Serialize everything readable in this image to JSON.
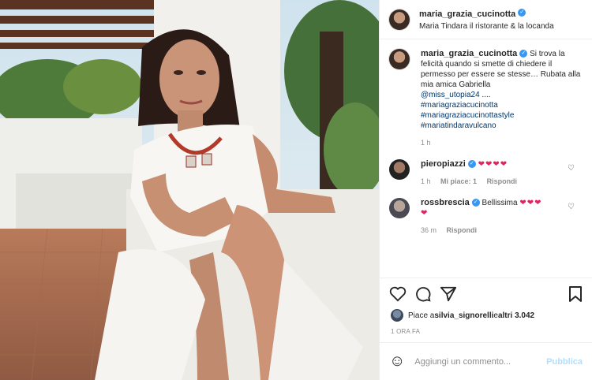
{
  "header": {
    "username": "maria_grazia_cucinotta",
    "location": "Maria Tindara il ristorante & la locanda",
    "verified_icon": "✓"
  },
  "caption": {
    "username": "maria_grazia_cucinotta",
    "text": "Si trova la felicità quando si smette di chiedere il permesso per essere se stesse… Rubata alla mia amica Gabriella",
    "mention": "@miss_utopia24",
    "ellipsis": " ....",
    "hashtags": [
      "#mariagraziacucinotta",
      "#mariagraziacucinottastyle",
      "#mariatindaravulcano"
    ],
    "time": "1 h"
  },
  "comments": [
    {
      "username": "pieropiazzi",
      "text": "❤❤❤❤",
      "time": "1 h",
      "likes": "Mi piace: 1",
      "reply": "Rispondi"
    },
    {
      "username": "rossbrescia",
      "text": "Bellissima",
      "hearts": "❤❤❤",
      "hearts2": "❤",
      "time": "36 m",
      "reply": "Rispondi"
    }
  ],
  "likes": {
    "text_prefix": "Piace a ",
    "user": "silvia_signorelli",
    "text_mid": " e ",
    "others": "altri 3.042"
  },
  "timestamp": "1 ORA FA",
  "add_comment": {
    "placeholder": "Aggiungi un commento...",
    "publish": "Pubblica",
    "emoji_icon": "☺"
  },
  "colors": {
    "link": "#00376b",
    "verified": "#3897f0",
    "heart": "#e0245e",
    "publish": "#b2dffc"
  }
}
